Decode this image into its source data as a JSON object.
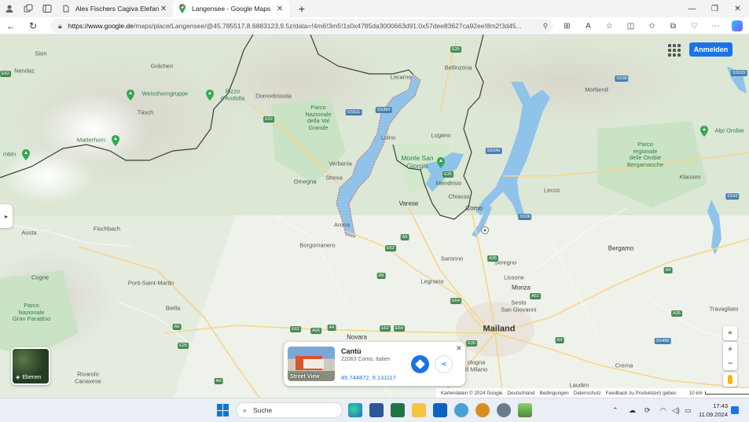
{
  "browser": {
    "tabs": [
      {
        "title": "Alex Fischers Cagiva Elefant-Seite",
        "active": false
      },
      {
        "title": "Langensee - Google Maps",
        "active": true
      }
    ],
    "url_host": "https://www.google.de",
    "url_rest": "/maps/place/Langensee/@45.785517,8.6883123,9.5z/data=!4m6!3m5!1s0x4785da3000663d91:0x57dee83627ca92ee!8m2!3d45..."
  },
  "map": {
    "signin_label": "Anmelden",
    "layers_label": "Ebenen",
    "places": {
      "sion": "Sion",
      "nendaz": "Nendaz",
      "grachen": "Grächen",
      "weisshorngruppe": "Weisshorngruppe",
      "tasch": "Täsch",
      "matterhorn": "Matterhorn",
      "zermatt_cut": "mbin",
      "pizzo": "Pizzo\nd'Andolla",
      "domodossola": "Domodossola",
      "valgrande": "Parco\nNazionale\ndella Val\nGrande",
      "verbania": "Verbania",
      "omegna": "Omegna",
      "stresa": "Stresa",
      "arona": "Arona",
      "luino": "Luino",
      "locarno": "Locarno",
      "bellinzona": "Bellinzona",
      "lugano": "Lugano",
      "montesangiorgio": "Monte San\nGiorgio",
      "mendrisio": "Mendrisio",
      "chiasso": "Chiasso",
      "varese": "Varese",
      "como": "Como",
      "lecco": "Lecco",
      "morbend": "Morbend",
      "alpiorobie": "Alpi Orobie",
      "parcoorobie": "Parco\nregionale\ndelle Orobie\nBergamasche",
      "klausen": "Klausen",
      "bergamo": "Bergamo",
      "aosta": "Aosta",
      "fischbach": "Fischbach",
      "borgomanero": "Borgomanero",
      "cogne": "Cogne",
      "pontsaintmartin": "Pont-Saint-Martin",
      "granparadiso": "Parco\nNazionale\nGran Paradiso",
      "biella": "Biella",
      "novara": "Novara",
      "saronno": "Saronno",
      "legnano": "Legnano",
      "seregno": "Seregno",
      "lissone": "Lissone",
      "monza": "Monza",
      "sesto": "Sesto\nSan Giovanni",
      "mailand": "Mailand",
      "crema": "Crema",
      "travagliato": "Travagliato",
      "rivarolo": "Rivarolo\nCanavese",
      "cinisello": "ologna\nd Milano",
      "lauden": "Lauden"
    },
    "routes": [
      "E62",
      "E62",
      "SS631",
      "SS394",
      "E35",
      "SS340",
      "E62",
      "E35",
      "A8",
      "A8",
      "A26",
      "E62",
      "E64",
      "A4",
      "E64",
      "A51",
      "A4",
      "E25",
      "A5",
      "E35",
      "A4",
      "SS498",
      "A35",
      "SS36",
      "SS38",
      "A35",
      "E62",
      "A4",
      "SS42",
      "SS539"
    ],
    "card": {
      "name": "Cantù",
      "address": "22063 Como, Italien",
      "coords": "45.744872, 9.131117",
      "streetview_label": "Street View"
    },
    "footer": {
      "data": "Kartendaten © 2024 Google",
      "country": "Deutschland",
      "terms": "Bedingungen",
      "privacy": "Datenschutz",
      "feedback": "Feedback zu Produkt(en) geben",
      "scale": "10 km"
    }
  },
  "taskbar": {
    "search_label": "Suche",
    "time": "17:43",
    "date": "11.09.2024"
  },
  "colors": {
    "accent": "#1a73e8",
    "lake": "#8fc3ea",
    "border": "#3c3c3c",
    "park": "#c9e3c4"
  }
}
